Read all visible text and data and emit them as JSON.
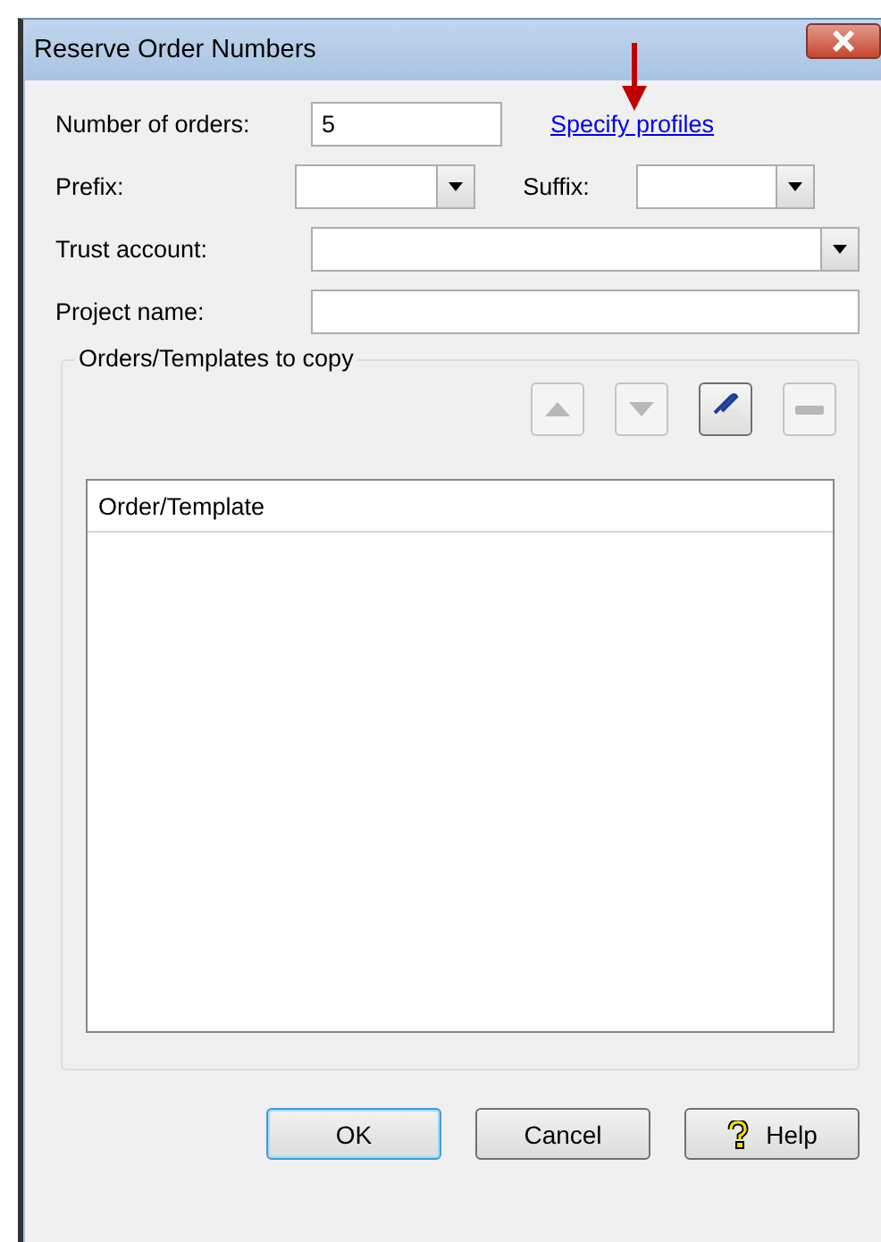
{
  "window": {
    "title": "Reserve Order Numbers"
  },
  "annotation": {
    "kind": "arrow"
  },
  "number_of_orders": {
    "label": "Number of orders:",
    "value": "5"
  },
  "link": "Specify profiles",
  "prefix": {
    "label": "Prefix:"
  },
  "suffix": {
    "label": "Suffix:"
  },
  "trust_account": {
    "label": "Trust account:"
  },
  "project_name": {
    "label": "Project name:"
  },
  "group": {
    "title": "Orders/Templates to copy",
    "tools": [
      {
        "kind": "up",
        "disabled": true
      },
      {
        "kind": "down",
        "disabled": true
      },
      {
        "kind": "edit",
        "disabled": false
      },
      {
        "kind": "remove",
        "disabled": true
      }
    ],
    "table": {
      "columns": [
        "Order/Template"
      ]
    }
  },
  "buttons": [
    {
      "label": "OK",
      "kind": "plain",
      "default": true
    },
    {
      "label": "Cancel",
      "kind": "plain",
      "default": false
    },
    {
      "label": "Help",
      "kind": "help",
      "default": false
    }
  ]
}
